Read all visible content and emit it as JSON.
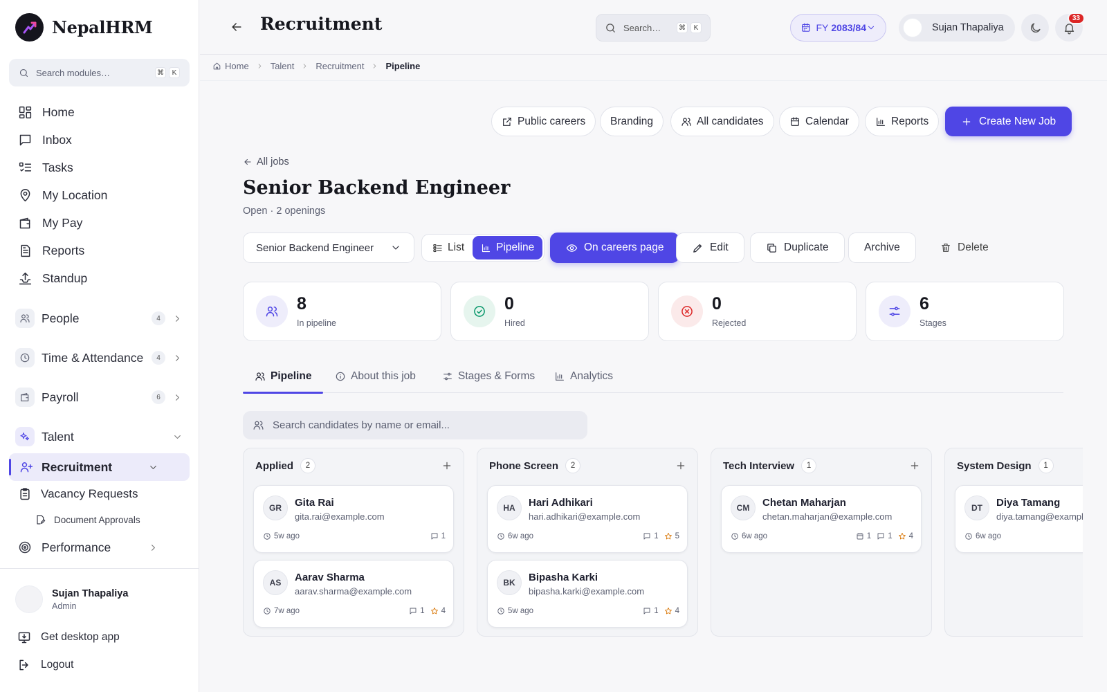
{
  "brand": {
    "name": "NepalHRM"
  },
  "sidebar": {
    "search_placeholder": "Search modules…",
    "kbd": [
      "⌘",
      "K"
    ],
    "nav": [
      {
        "label": "Home",
        "icon": "grid-icon"
      },
      {
        "label": "Inbox",
        "icon": "message-icon"
      },
      {
        "label": "Tasks",
        "icon": "tasks-icon"
      },
      {
        "label": "My Location",
        "icon": "map-pin-icon"
      },
      {
        "label": "My Pay",
        "icon": "wallet-icon"
      },
      {
        "label": "Reports",
        "icon": "document-icon"
      },
      {
        "label": "Standup",
        "icon": "standup-icon"
      }
    ],
    "groups": [
      {
        "label": "People",
        "count": "4"
      },
      {
        "label": "Time & Attendance",
        "count": "4"
      },
      {
        "label": "Payroll",
        "count": "6"
      },
      {
        "label": "Talent"
      }
    ],
    "recruitment": "Recruitment",
    "vacancy": "Vacancy Requests",
    "doc_approvals": "Document Approvals",
    "performance": "Performance",
    "user": {
      "name": "Sujan Thapaliya",
      "role": "Admin"
    },
    "desktop": "Get desktop app",
    "logout": "Logout"
  },
  "topbar": {
    "title": "Recruitment",
    "search_placeholder": "Search…",
    "fy_prefix": "FY",
    "fy_value": "2083/84",
    "user_name": "Sujan Thapaliya",
    "notif_count": "33"
  },
  "breadcrumb": [
    "Home",
    "Talent",
    "Recruitment",
    "Pipeline"
  ],
  "actions": {
    "public_careers": "Public careers",
    "branding": "Branding",
    "all_candidates": "All candidates",
    "calendar": "Calendar",
    "reports": "Reports",
    "create_job": "Create New Job"
  },
  "job": {
    "back": "All jobs",
    "title": "Senior Backend Engineer",
    "subtitle": "Open · 2 openings",
    "selected": "Senior Backend Engineer",
    "view_list": "List",
    "view_pipeline": "Pipeline",
    "careers": "On careers page",
    "edit": "Edit",
    "duplicate": "Duplicate",
    "archive": "Archive",
    "delete": "Delete"
  },
  "stats": [
    {
      "value": "8",
      "label": "In pipeline",
      "color": "#4f46e5",
      "bg": "#eeedfb"
    },
    {
      "value": "0",
      "label": "Hired",
      "color": "#059669",
      "bg": "#e6f5ee"
    },
    {
      "value": "0",
      "label": "Rejected",
      "color": "#dc2626",
      "bg": "#fbeaea"
    },
    {
      "value": "6",
      "label": "Stages",
      "color": "#4f46e5",
      "bg": "#eeedfb"
    }
  ],
  "tabs": [
    "Pipeline",
    "About this job",
    "Stages & Forms",
    "Analytics"
  ],
  "candidate_search_placeholder": "Search candidates by name or email...",
  "columns": [
    {
      "name": "Applied",
      "count": "2",
      "cards": [
        {
          "initials": "GR",
          "name": "Gita Rai",
          "email": "gita.rai@example.com",
          "time": "5w ago",
          "comments": "1"
        },
        {
          "initials": "AS",
          "name": "Aarav Sharma",
          "email": "aarav.sharma@example.com",
          "time": "7w ago",
          "comments": "1",
          "rating": "4"
        }
      ]
    },
    {
      "name": "Phone Screen",
      "count": "2",
      "cards": [
        {
          "initials": "HA",
          "name": "Hari Adhikari",
          "email": "hari.adhikari@example.com",
          "time": "6w ago",
          "comments": "1",
          "rating": "5"
        },
        {
          "initials": "BK",
          "name": "Bipasha Karki",
          "email": "bipasha.karki@example.com",
          "time": "5w ago",
          "comments": "1",
          "rating": "4"
        }
      ]
    },
    {
      "name": "Tech Interview",
      "count": "1",
      "cards": [
        {
          "initials": "CM",
          "name": "Chetan Maharjan",
          "email": "chetan.maharjan@example.com",
          "time": "6w ago",
          "events": "1",
          "comments": "1",
          "rating": "4"
        }
      ]
    },
    {
      "name": "System Design",
      "count": "1",
      "cards": [
        {
          "initials": "DT",
          "name": "Diya Tamang",
          "email": "diya.tamang@example.com",
          "time": "6w ago"
        }
      ]
    }
  ],
  "colors": {
    "accent": "#4f46e5",
    "danger": "#dc2626",
    "success": "#059669",
    "star": "#d97706"
  }
}
